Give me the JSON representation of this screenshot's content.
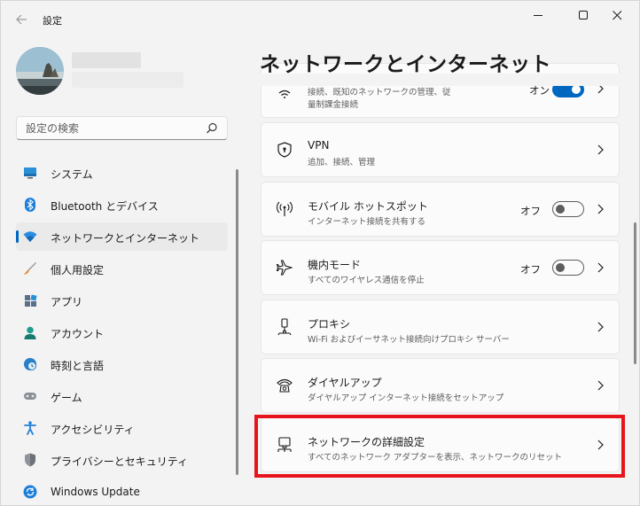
{
  "window": {
    "title": "設定",
    "back_icon": "arrow-left-icon",
    "controls": [
      "minimize-icon",
      "maximize-icon",
      "close-icon"
    ]
  },
  "search": {
    "placeholder": "設定の検索"
  },
  "sidebar": {
    "items": [
      {
        "label": "システム",
        "icon": "system-display-icon",
        "selected": false
      },
      {
        "label": "Bluetooth とデバイス",
        "icon": "bluetooth-icon",
        "selected": false
      },
      {
        "label": "ネットワークとインターネット",
        "icon": "wifi-icon",
        "selected": true
      },
      {
        "label": "個人用設定",
        "icon": "brush-icon",
        "selected": false
      },
      {
        "label": "アプリ",
        "icon": "apps-icon",
        "selected": false
      },
      {
        "label": "アカウント",
        "icon": "person-icon",
        "selected": false
      },
      {
        "label": "時刻と言語",
        "icon": "globe-clock-icon",
        "selected": false
      },
      {
        "label": "ゲーム",
        "icon": "gamepad-icon",
        "selected": false
      },
      {
        "label": "アクセシビリティ",
        "icon": "accessibility-icon",
        "selected": false
      },
      {
        "label": "プライバシーとセキュリティ",
        "icon": "shield-icon",
        "selected": false
      },
      {
        "label": "Windows Update",
        "icon": "update-icon",
        "selected": false
      }
    ]
  },
  "main": {
    "title": "ネットワークとインターネット",
    "cards": [
      {
        "title": "",
        "desc": "量制課金接続",
        "desc_partial": "接続、既知のネットワークの管理、従",
        "icon": "wifi-icon",
        "state": "オン",
        "toggle": true
      },
      {
        "title": "VPN",
        "desc": "追加、接続、管理",
        "icon": "vpn-shield-icon"
      },
      {
        "title": "モバイル ホットスポット",
        "desc": "インターネット接続を共有する",
        "icon": "hotspot-icon",
        "state": "オフ",
        "toggle": false
      },
      {
        "title": "機内モード",
        "desc": "すべてのワイヤレス通信を停止",
        "icon": "airplane-icon",
        "state": "オフ",
        "toggle": false
      },
      {
        "title": "プロキシ",
        "desc": "Wi-Fi およびイーサネット接続向けプロキシ サーバー",
        "icon": "proxy-icon"
      },
      {
        "title": "ダイヤルアップ",
        "desc": "ダイヤルアップ インターネット接続をセットアップ",
        "icon": "dialup-icon"
      },
      {
        "title": "ネットワークの詳細設定",
        "desc": "すべてのネットワーク アダプターを表示、ネットワークのリセット",
        "icon": "network-adapter-icon"
      }
    ]
  },
  "colors": {
    "accent": "#0067c0",
    "highlight": "#e8141c",
    "background": "#f3f3f3",
    "card": "#fbfbfb"
  }
}
